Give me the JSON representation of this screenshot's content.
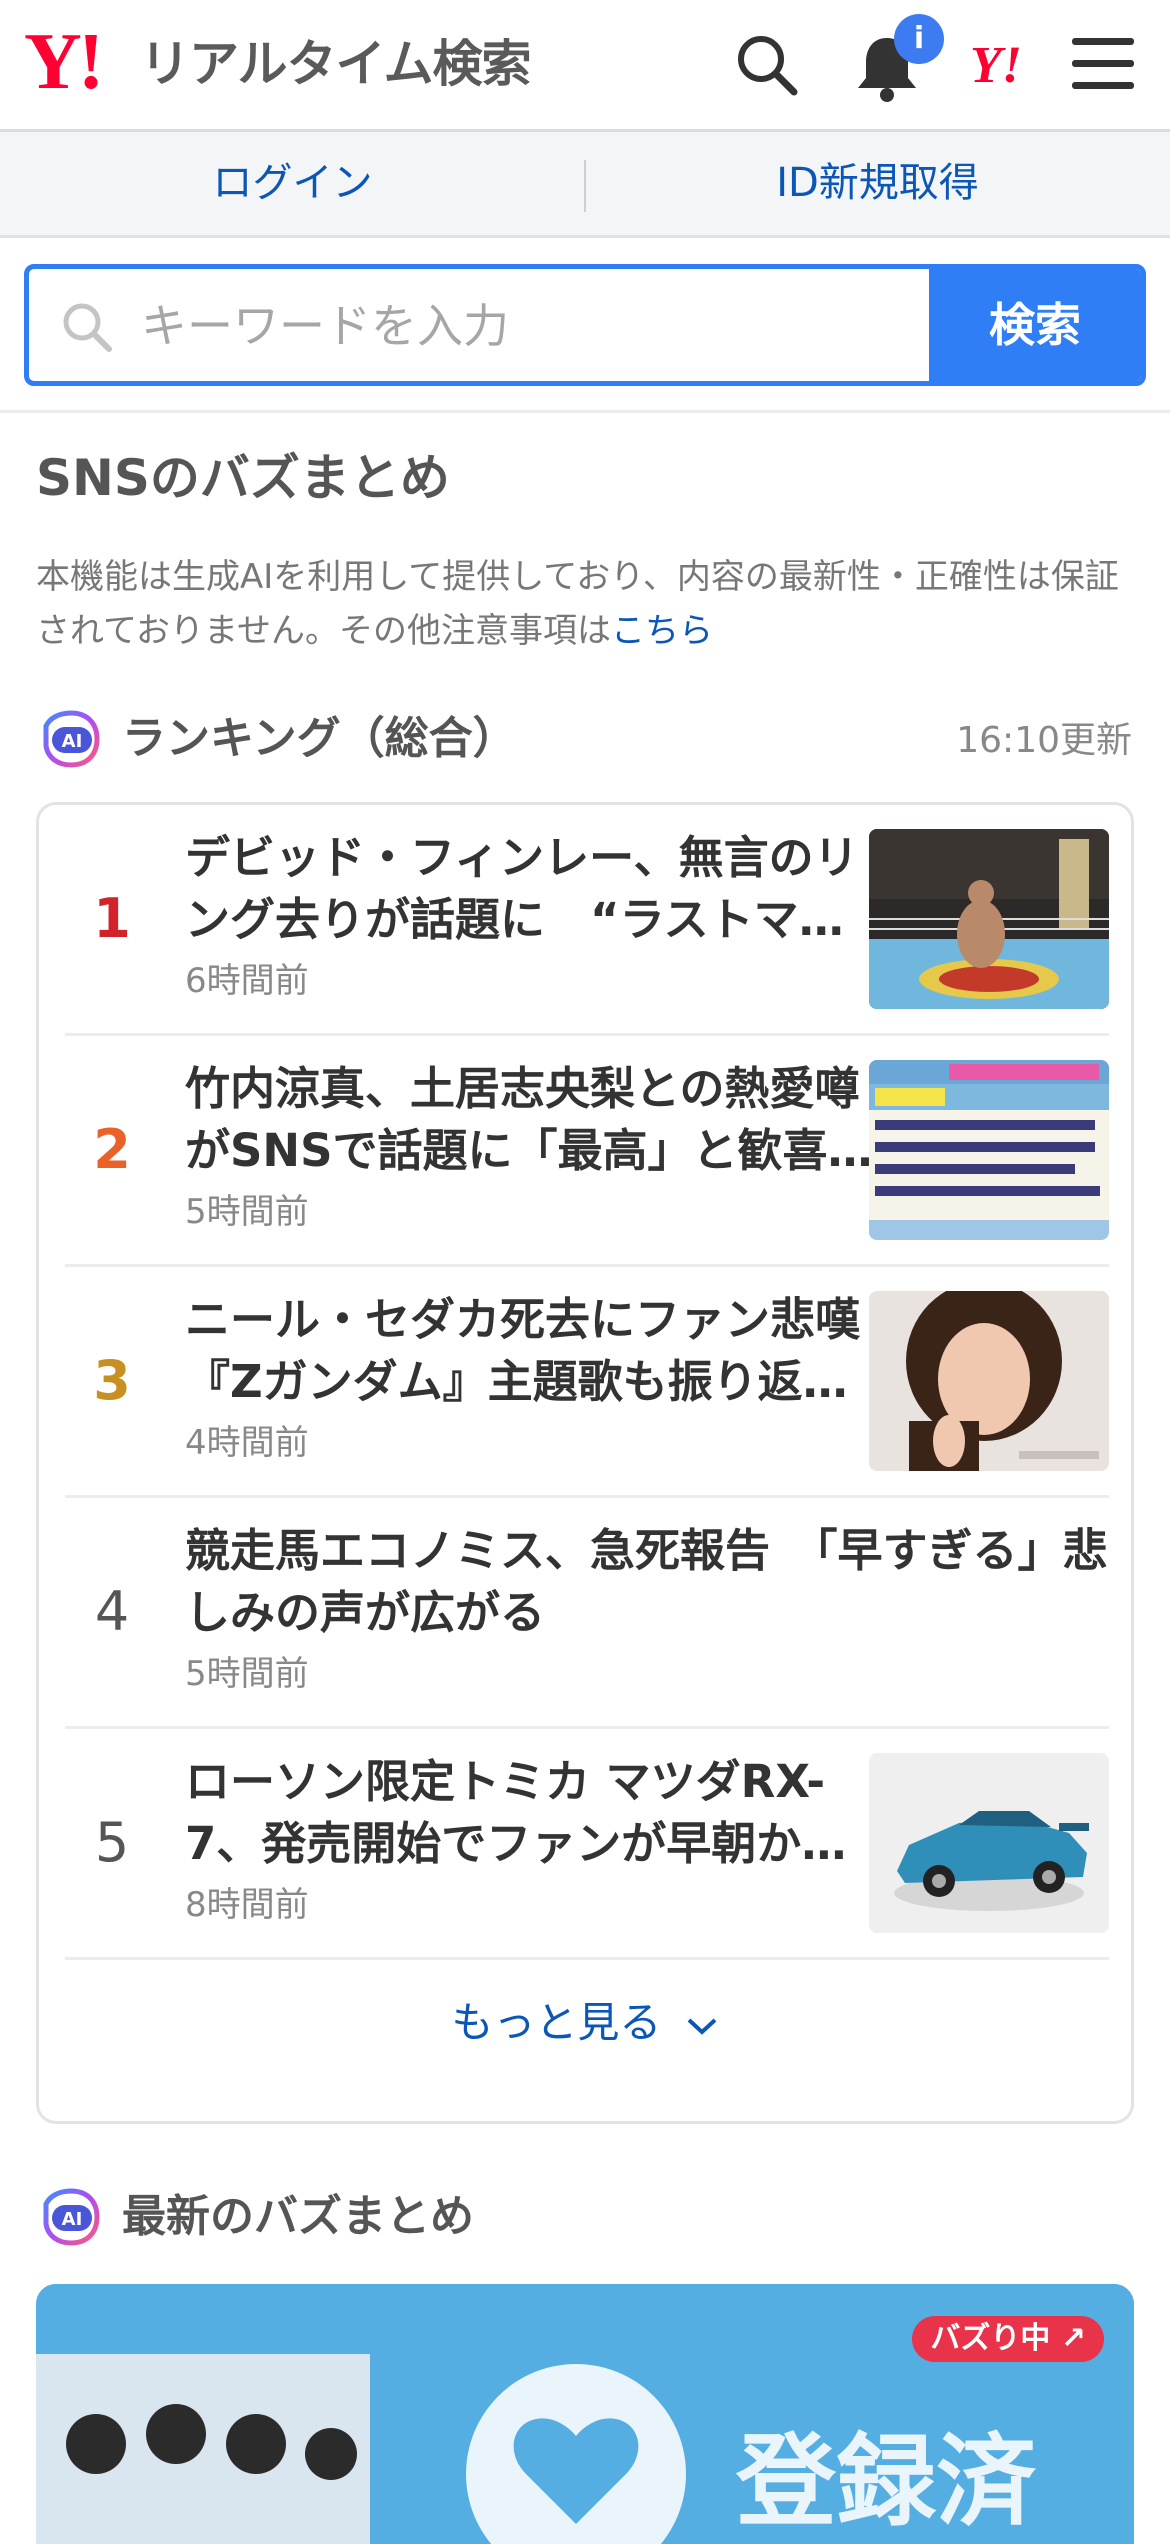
{
  "header": {
    "logo_mark": "Y!",
    "logo_text": "リアルタイム検索",
    "notification_badge": "i",
    "yahoo_mark": "Y!"
  },
  "auth": {
    "login": "ログイン",
    "register": "ID新規取得"
  },
  "search": {
    "placeholder": "キーワードを入力",
    "button": "検索"
  },
  "page": {
    "title": "SNSのバズまとめ",
    "disclaimer": "本機能は生成AIを利用して提供しており、内容の最新性・正確性は保証されておりません。その他注意事項は",
    "disclaimer_link": "こちら"
  },
  "ranking": {
    "ai_label": "AI",
    "title": "ランキング（総合）",
    "updated": "16:10更新",
    "items": [
      {
        "rank": "1",
        "title": "デビッド・フィンレー、無言のリング去りが話題に　“ラストマッチ”",
        "time": "6時間前",
        "rank_color": "#d1232a",
        "thumb": "wrestling-ring"
      },
      {
        "rank": "2",
        "title": "竹内涼真、土居志央梨との熱愛噂がSNSで話題に「最高」と歓喜の声",
        "time": "5時間前",
        "rank_color": "#e8622a",
        "thumb": "tv-caption"
      },
      {
        "rank": "3",
        "title": "ニール・セダカ死去にファン悲嘆『Zガンダム』主題歌も振り返る声",
        "time": "4時間前",
        "rank_color": "#c89020",
        "thumb": "idol-portrait"
      },
      {
        "rank": "4",
        "title": "競走馬エコノミス、急死報告　「早すぎる」悲しみの声が広がる",
        "time": "5時間前",
        "rank_color": "#555555",
        "thumb": ""
      },
      {
        "rank": "5",
        "title": "ローソン限定トミカ マツダRX-7、発売開始でファンが早朝から行列",
        "time": "8時間前",
        "rank_color": "#555555",
        "thumb": "toy-car"
      }
    ],
    "more": "もっと見る"
  },
  "latest": {
    "ai_label": "AI",
    "title": "最新のバズまとめ",
    "badge": "バズり中",
    "overlay_text": "登録済"
  }
}
